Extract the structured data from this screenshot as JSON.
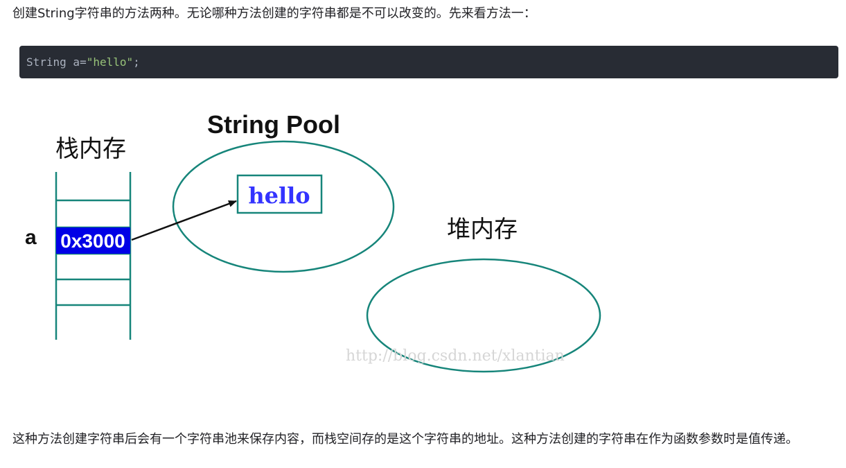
{
  "paragraph_intro": "创建String字符串的方法两种。无论哪种方法创建的字符串都是不可以改变的。先来看方法一：",
  "code": {
    "prefix": "String a=",
    "string_literal": "\"hello\"",
    "suffix": ";"
  },
  "diagram": {
    "stack_label": "栈内存",
    "pool_label": "String Pool",
    "heap_label": "堆内存",
    "var_name": "a",
    "address": "0x3000",
    "pool_value": "hello",
    "watermark": "http://blog.csdn.net/xlantian"
  },
  "paragraph_explain": "这种方法创建字符串后会有一个字符串池来保存内容，而栈空间存的是这个字符串的地址。这种方法创建的字符串在作为函数参数时是值传递。",
  "colors": {
    "code_bg": "#282c34",
    "ellipse_stroke": "#16857a",
    "address_bg": "#0000e6",
    "hello_text": "#3333ff"
  }
}
